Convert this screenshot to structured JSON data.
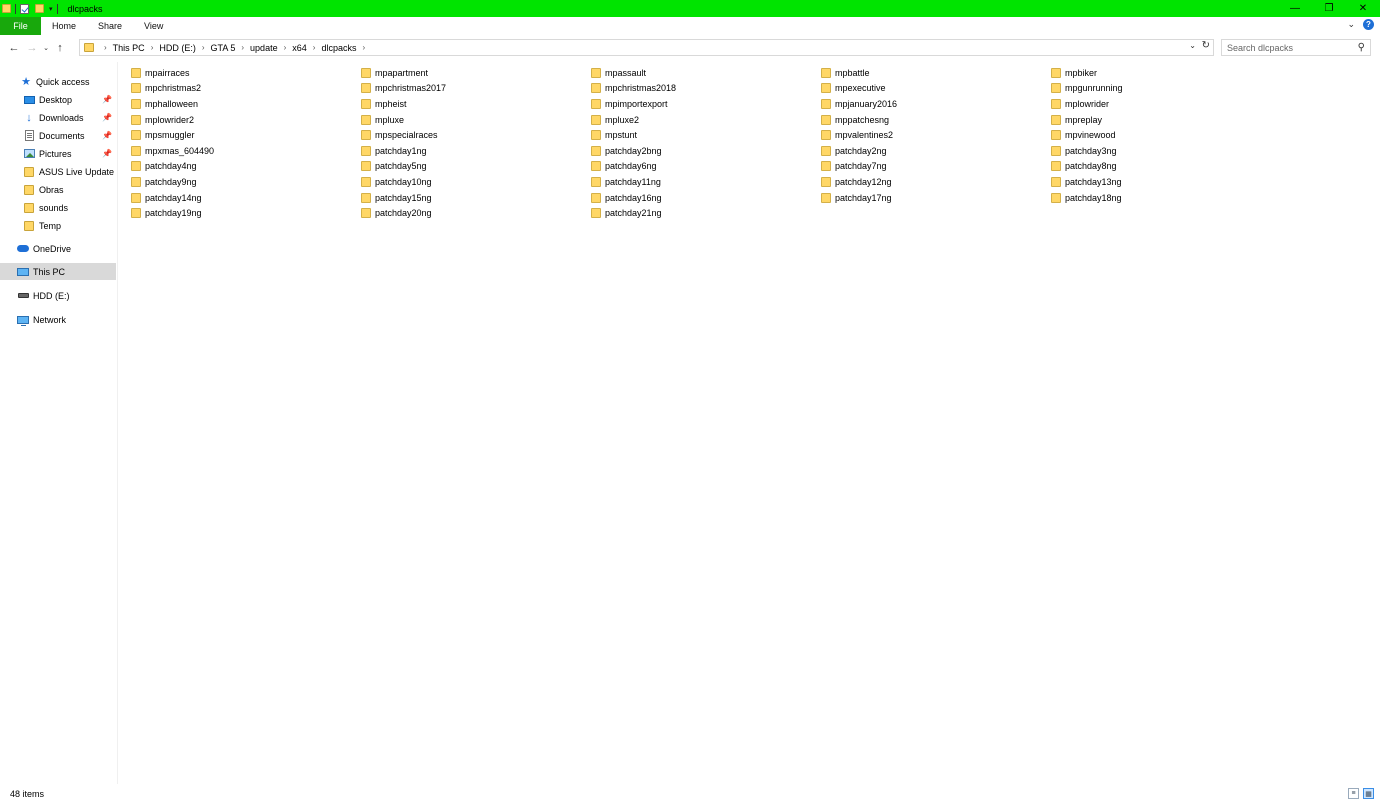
{
  "window": {
    "title": "dlcpacks",
    "minimize": "—",
    "restore": "❐",
    "close": "✕"
  },
  "ribbon": {
    "tabs": [
      "File",
      "Home",
      "Share",
      "View"
    ],
    "collapse_icon": "chevron-down-icon",
    "help_label": "?"
  },
  "address": {
    "breadcrumbs": [
      "This PC",
      "HDD (E:)",
      "GTA 5",
      "update",
      "x64",
      "dlcpacks"
    ],
    "separator": "›"
  },
  "search": {
    "placeholder": "Search dlcpacks"
  },
  "nav": {
    "quick_access": "Quick access",
    "items": [
      {
        "label": "Desktop",
        "pinned": true
      },
      {
        "label": "Downloads",
        "pinned": true
      },
      {
        "label": "Documents",
        "pinned": true
      },
      {
        "label": "Pictures",
        "pinned": true
      },
      {
        "label": "ASUS Live Update",
        "pinned": false
      },
      {
        "label": "Obras",
        "pinned": false
      },
      {
        "label": "sounds",
        "pinned": false
      },
      {
        "label": "Temp",
        "pinned": false
      }
    ],
    "onedrive": "OneDrive",
    "this_pc": "This PC",
    "hdd": "HDD (E:)",
    "network": "Network",
    "selected": "This PC"
  },
  "folders": [
    "mpairraces",
    "mpapartment",
    "mpassault",
    "mpbattle",
    "mpbiker",
    "mpchristmas2",
    "mpchristmas2017",
    "mpchristmas2018",
    "mpexecutive",
    "mpgunrunning",
    "mphalloween",
    "mpheist",
    "mpimportexport",
    "mpjanuary2016",
    "mplowrider",
    "mplowrider2",
    "mpluxe",
    "mpluxe2",
    "mppatchesng",
    "mpreplay",
    "mpsmuggler",
    "mpspecialraces",
    "mpstunt",
    "mpvalentines2",
    "mpvinewood",
    "mpxmas_604490",
    "patchday1ng",
    "patchday2bng",
    "patchday2ng",
    "patchday3ng",
    "patchday4ng",
    "patchday5ng",
    "patchday6ng",
    "patchday7ng",
    "patchday8ng",
    "patchday9ng",
    "patchday10ng",
    "patchday11ng",
    "patchday12ng",
    "patchday13ng",
    "patchday14ng",
    "patchday15ng",
    "patchday16ng",
    "patchday17ng",
    "patchday18ng",
    "patchday19ng",
    "patchday20ng",
    "patchday21ng"
  ],
  "status": {
    "item_count": "48 items"
  },
  "colors": {
    "titlebar": "#00e400",
    "file_tab": "#18a80c",
    "folder": "#ffd766",
    "selection": "#d9d9d9"
  }
}
